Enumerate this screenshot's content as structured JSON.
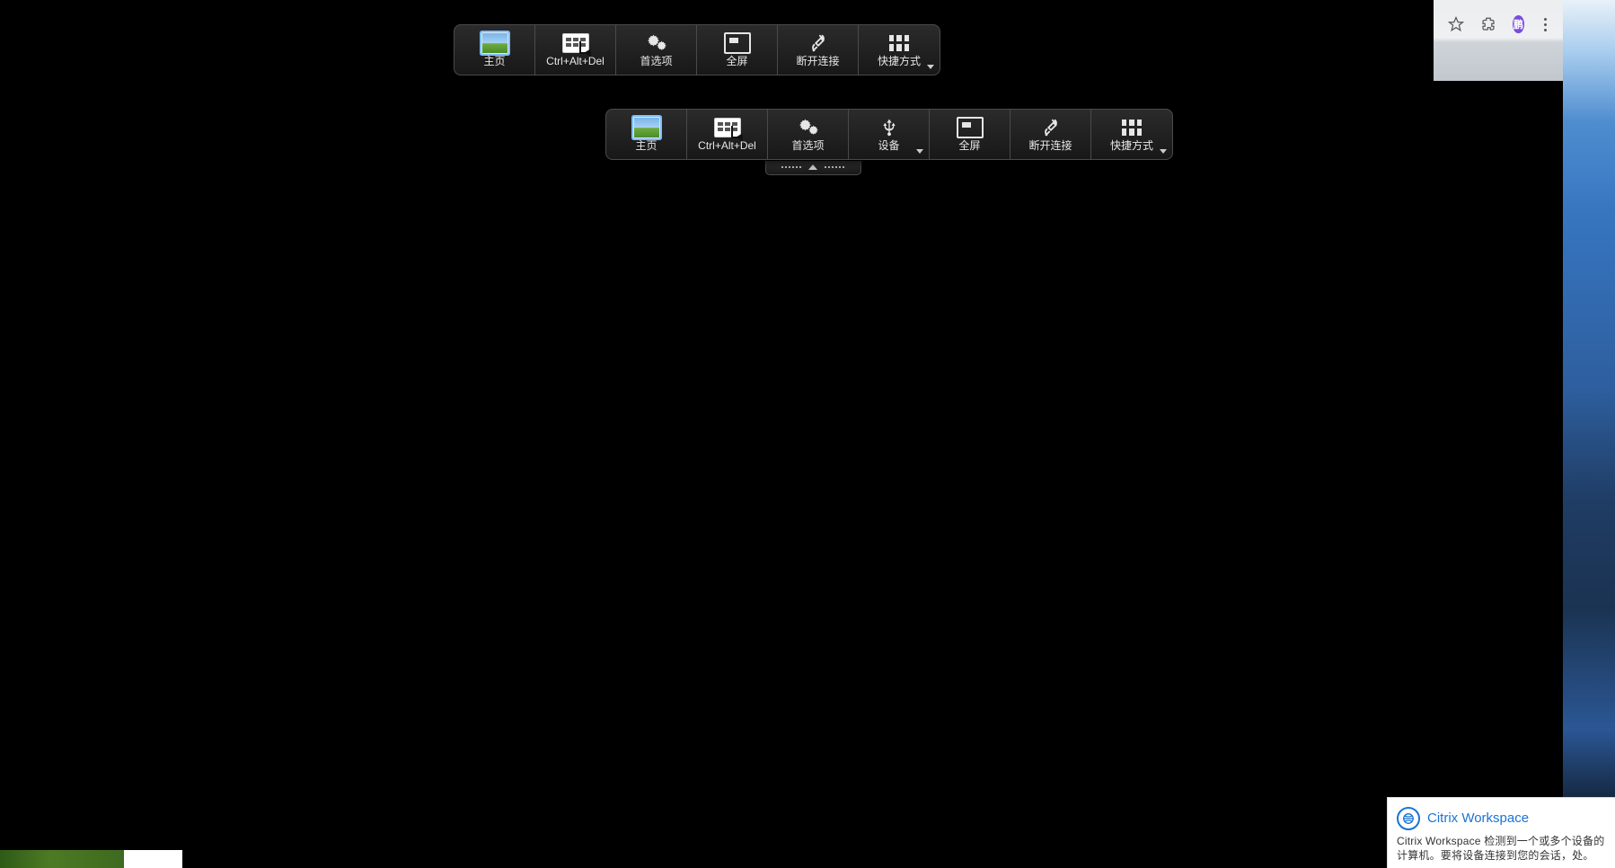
{
  "outerToolbar": {
    "items": [
      {
        "id": "home",
        "label": "主页"
      },
      {
        "id": "cad",
        "label": "Ctrl+Alt+Del"
      },
      {
        "id": "prefs",
        "label": "首选项"
      },
      {
        "id": "fullscreen",
        "label": "全屏"
      },
      {
        "id": "disconnect",
        "label": "断开连接"
      },
      {
        "id": "shortcuts",
        "label": "快捷方式"
      }
    ]
  },
  "innerToolbar": {
    "items": [
      {
        "id": "home",
        "label": "主页"
      },
      {
        "id": "cad",
        "label": "Ctrl+Alt+Del"
      },
      {
        "id": "prefs",
        "label": "首选项"
      },
      {
        "id": "devices",
        "label": "设备"
      },
      {
        "id": "fullscreen",
        "label": "全屏"
      },
      {
        "id": "disconnect",
        "label": "断开连接"
      },
      {
        "id": "shortcuts",
        "label": "快捷方式"
      }
    ]
  },
  "browserCorner": {
    "avatarInitial": "鹏"
  },
  "citrixToast": {
    "title": "Citrix Workspace",
    "body": "Citrix Workspace 检测到一个或多个设备的计算机。要将设备连接到您的会话，处。"
  }
}
